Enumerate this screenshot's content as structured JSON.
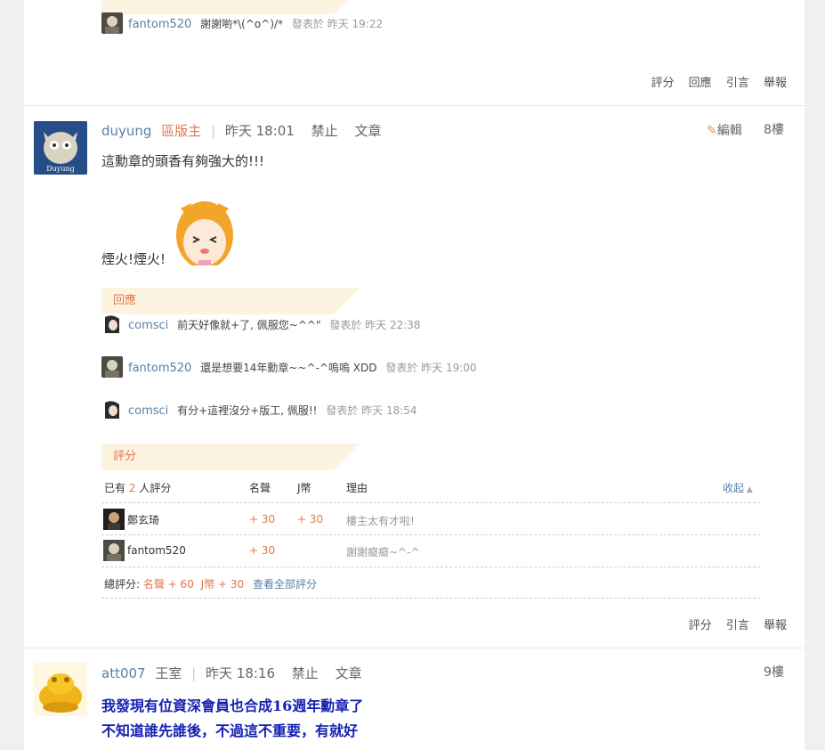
{
  "posts": [
    {
      "reply_top": {
        "user": "fantom520",
        "message": "謝謝喲*\\(^o^)/*",
        "date": "發表於 昨天 19:22"
      },
      "actions": [
        "評分",
        "回應",
        "引言",
        "舉報"
      ]
    },
    {
      "username": "duyung",
      "role": "區版主",
      "time": "昨天 18:01",
      "links": [
        "禁止",
        "文章"
      ],
      "edit": "編輯",
      "floor": "8樓",
      "content_line1": "這勳章的頭香有夠強大的!!!",
      "content_line2": "煙火!煙火!",
      "avatar_caption": "Duyung",
      "reply_label": "回應",
      "replies": [
        {
          "user": "comsci",
          "message": "前天好像就+了, 佩服您~^^\"",
          "date": "發表於 昨天 22:38"
        },
        {
          "user": "fantom520",
          "message": "還是想要14年勳章~~^-^嗚嗚 XDD",
          "date": "發表於 昨天 19:00"
        },
        {
          "user": "comsci",
          "message": "有分+這裡沒分+版工, 佩服!!",
          "date": "發表於 昨天 18:54"
        }
      ],
      "rating": {
        "label": "評分",
        "header_prefix": "已有",
        "header_count": "2",
        "header_suffix": "人評分",
        "col_prestige": "名聲",
        "col_coin": "J幣",
        "col_reason": "理由",
        "collapse": "收起",
        "rows": [
          {
            "user": "鄭玄琦",
            "prestige": "+ 30",
            "coin": "+ 30",
            "reason": "樓主太有才啦!"
          },
          {
            "user": "fantom520",
            "prestige": "+ 30",
            "coin": "",
            "reason": "謝謝癡癡~^-^"
          }
        ],
        "total_prefix": "總評分:",
        "total_prestige": "名聲 + 60",
        "total_coin": "J幣 + 30",
        "view_all": "查看全部評分"
      },
      "actions": [
        "評分",
        "引言",
        "舉報"
      ]
    },
    {
      "username": "att007",
      "role": "王室",
      "time": "昨天 18:16",
      "links": [
        "禁止",
        "文章"
      ],
      "floor": "9樓",
      "content_line1": "我發現有位資深會員也合成16週年勳章了",
      "content_line2": "不知道誰先誰後，不過這不重要，有就好"
    }
  ],
  "colors": {
    "accent": "#e2774a",
    "link": "#5a7fa6",
    "ribbon": "#fdf3e1",
    "highlight_text": "#1521b3"
  }
}
